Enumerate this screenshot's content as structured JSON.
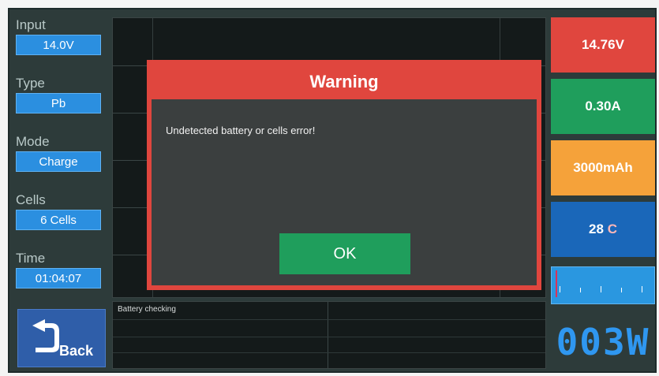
{
  "sidebar": {
    "fields": [
      {
        "label": "Input",
        "value": "14.0V"
      },
      {
        "label": "Type",
        "value": "Pb"
      },
      {
        "label": "Mode",
        "value": "Charge"
      },
      {
        "label": "Cells",
        "value": "6 Cells"
      },
      {
        "label": "Time",
        "value": "01:04:07"
      }
    ],
    "back_label": "Back"
  },
  "graph": {
    "status_text": "Battery checking"
  },
  "stats": {
    "voltage": "14.76V",
    "current": "0.30A",
    "capacity": "3000mAh",
    "temperature_value": "28",
    "temperature_unit": "C",
    "power": "003W"
  },
  "dialog": {
    "title": "Warning",
    "message": "Undetected battery or cells error!",
    "ok_label": "OK"
  },
  "colors": {
    "red": "#e0463e",
    "green": "#1f9e5c",
    "orange": "#f5a23a",
    "blue": "#1a67b9",
    "field_blue": "#2b8fe0"
  }
}
